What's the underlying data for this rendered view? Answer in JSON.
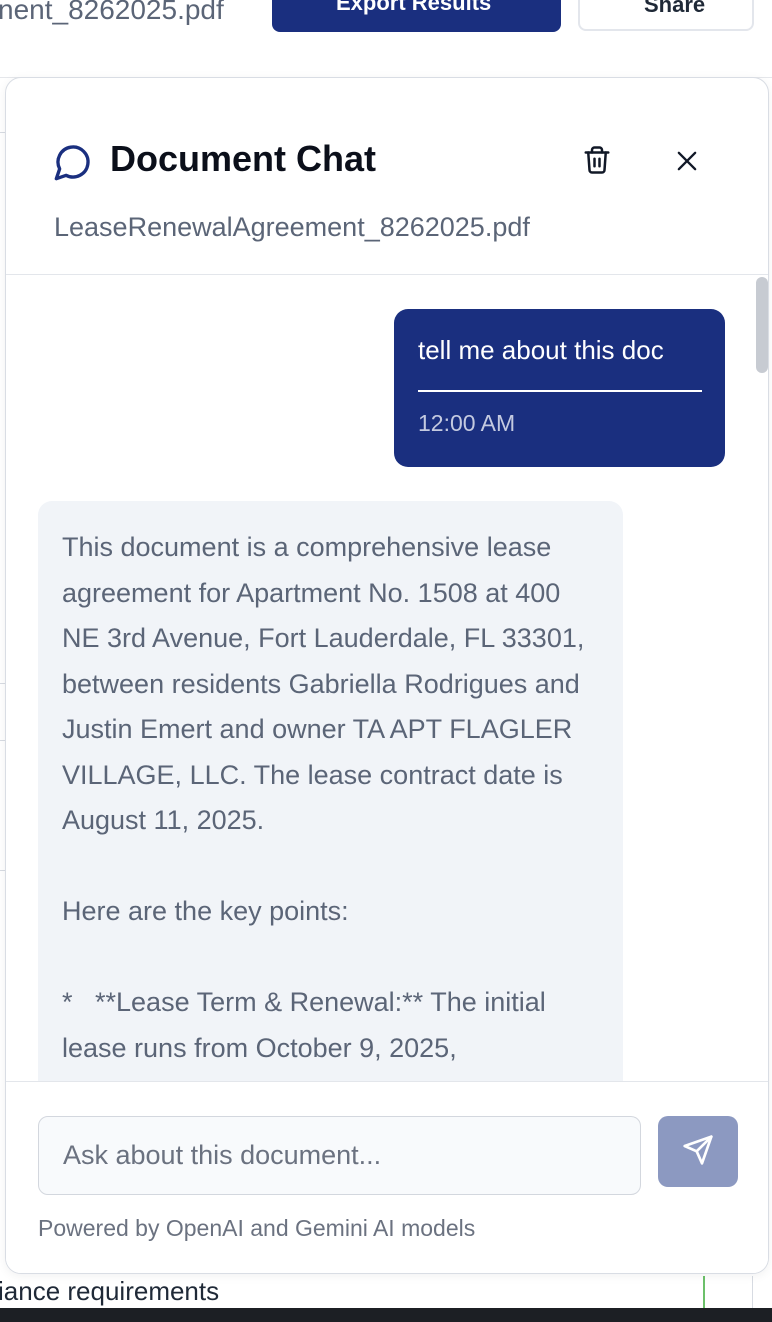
{
  "background": {
    "filename_text": "nent_8262025.pdf",
    "export_button_label": "Export Results",
    "share_button_label": "Share",
    "row_text": "iance requirements"
  },
  "dialog": {
    "title": "Document Chat",
    "filename": "LeaseRenewalAgreement_8262025.pdf",
    "icons": {
      "title": "chat-bubble-icon",
      "delete": "trash-icon",
      "close": "close-icon",
      "send": "send-icon"
    },
    "messages": [
      {
        "role": "user",
        "text": "tell me about this doc",
        "time": "12:00 AM"
      },
      {
        "role": "assistant",
        "text": "This document is a comprehensive lease agreement for Apartment No. 1508 at 400 NE 3rd Avenue, Fort Lauderdale, FL 33301, between residents Gabriella Rodrigues and Justin Emert and owner TA APT FLAGLER VILLAGE, LLC. The lease contract date is August 11, 2025.\n\nHere are the key points:\n\n*   **Lease Term & Renewal:** The initial lease runs from October 9, 2025,"
      }
    ],
    "input": {
      "placeholder": "Ask about this document...",
      "value": ""
    },
    "powered_by": "Powered by OpenAI and Gemini AI models"
  },
  "colors": {
    "primary": "#1a2f7f",
    "send_button": "#8c99c1",
    "assistant_bubble": "#f1f4f8",
    "muted_text": "#5b6577"
  }
}
